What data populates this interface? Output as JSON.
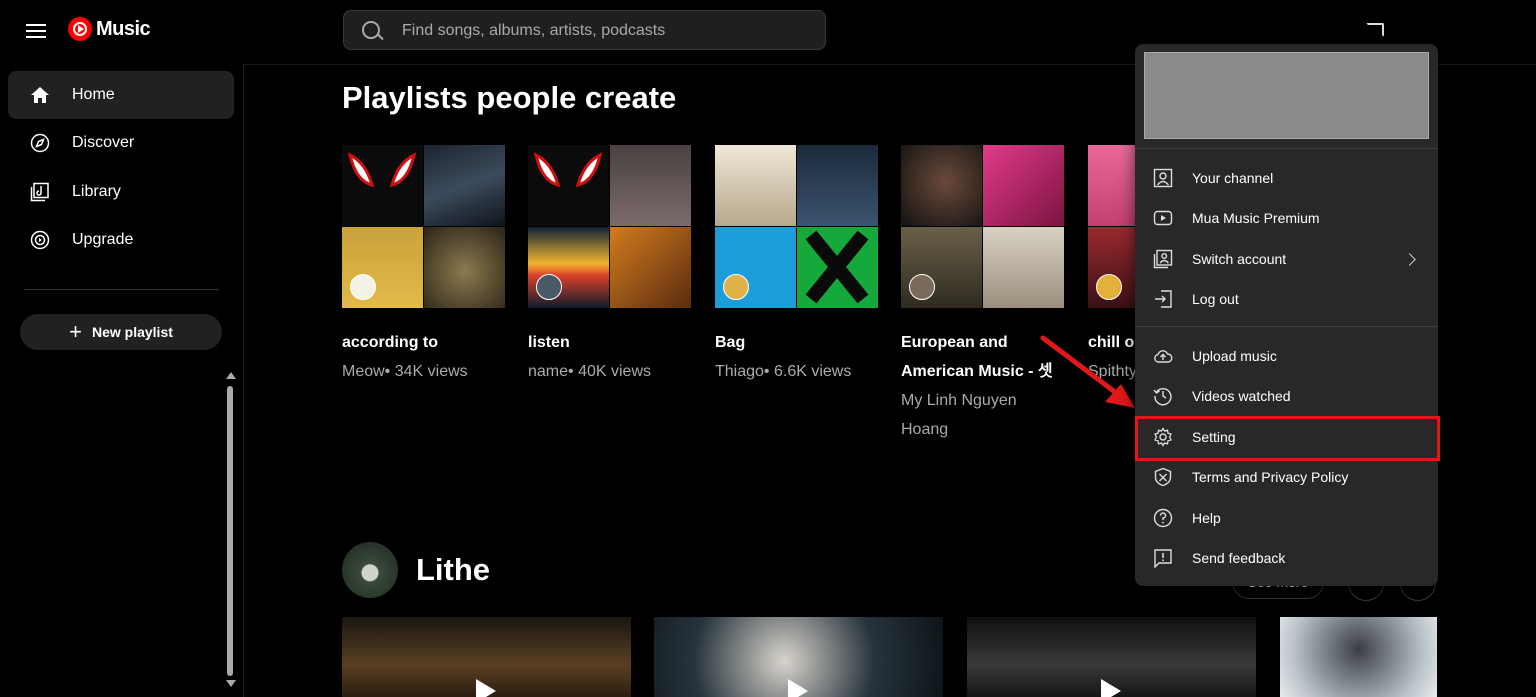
{
  "app": {
    "logo_text": "Music"
  },
  "search": {
    "placeholder": "Find songs, albums, artists, podcasts"
  },
  "sidebar": {
    "items": [
      {
        "label": "Home",
        "icon": "home-icon",
        "active": true
      },
      {
        "label": "Discover",
        "icon": "compass-icon",
        "active": false
      },
      {
        "label": "Library",
        "icon": "library-icon",
        "active": false
      },
      {
        "label": "Upgrade",
        "icon": "upgrade-icon",
        "active": false
      }
    ],
    "new_playlist_label": "New playlist"
  },
  "main": {
    "section_title": "Playlists people create",
    "playlists": [
      {
        "title": "according to",
        "subtitle": "Meow• 34K views"
      },
      {
        "title": "listen",
        "subtitle": "name• 40K views"
      },
      {
        "title": "Bag",
        "subtitle": "Thiago• 6.6K views"
      },
      {
        "title": "European and American Music - 셋",
        "subtitle": "My Linh Nguyen Hoang"
      },
      {
        "title": "chill ou",
        "subtitle": "Spithty"
      }
    ],
    "artist": {
      "name": "Lithe",
      "see_more": "See more"
    }
  },
  "account_menu": {
    "items": [
      {
        "label": "Your channel",
        "icon": "person-box-icon"
      },
      {
        "label": "Mua Music Premium",
        "icon": "play-box-icon"
      },
      {
        "label": "Switch account",
        "icon": "switch-account-icon",
        "has_submenu": true
      },
      {
        "label": "Log out",
        "icon": "logout-icon"
      },
      {
        "label": "Upload music",
        "icon": "upload-cloud-icon"
      },
      {
        "label": "Videos watched",
        "icon": "history-icon"
      },
      {
        "label": "Setting",
        "icon": "gear-icon",
        "highlighted": true
      },
      {
        "label": "Terms and Privacy Policy",
        "icon": "shield-icon"
      },
      {
        "label": "Help",
        "icon": "help-icon"
      },
      {
        "label": "Send feedback",
        "icon": "feedback-icon"
      }
    ]
  },
  "colors": {
    "accent": "#ff0000",
    "highlight_border": "#e01818",
    "menu_bg": "#282828"
  }
}
